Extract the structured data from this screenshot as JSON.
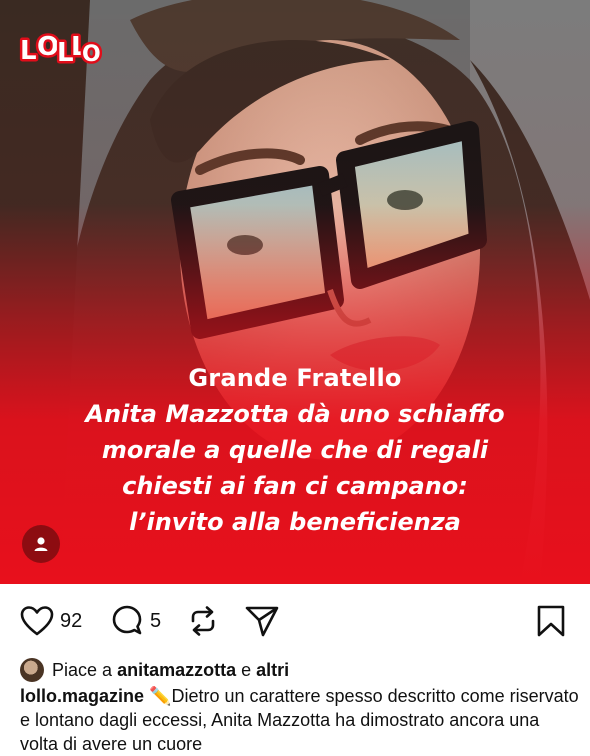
{
  "post": {
    "logo_text": "LOLLO",
    "headline_kicker": "Grande Fratello",
    "headline_lines": [
      "Anita Mazzotta dà uno schiaffo",
      "morale a quelle che di regali",
      "chiesti ai fan ci campano:",
      "l’invito alla beneficienza"
    ]
  },
  "actions": {
    "like_count": "92",
    "comment_count": "5"
  },
  "likes": {
    "prefix": "Piace a",
    "user": "anitamazzotta",
    "conj": "e",
    "others": "altri"
  },
  "caption": {
    "username": "lollo.magazine",
    "emoji": "✏️",
    "text": "Dietro un carattere spesso descritto come riservato e lontano dagli eccessi, Anita Mazzotta ha dimostrato ancora una volta di avere un cuore"
  },
  "colors": {
    "brand_red": "#e10d1a",
    "overlay_red": "#e8101c"
  },
  "icons": {
    "like": "heart-icon",
    "comment": "comment-icon",
    "repost": "repost-icon",
    "share": "send-icon",
    "save": "bookmark-icon",
    "tag": "user-tag-icon"
  }
}
